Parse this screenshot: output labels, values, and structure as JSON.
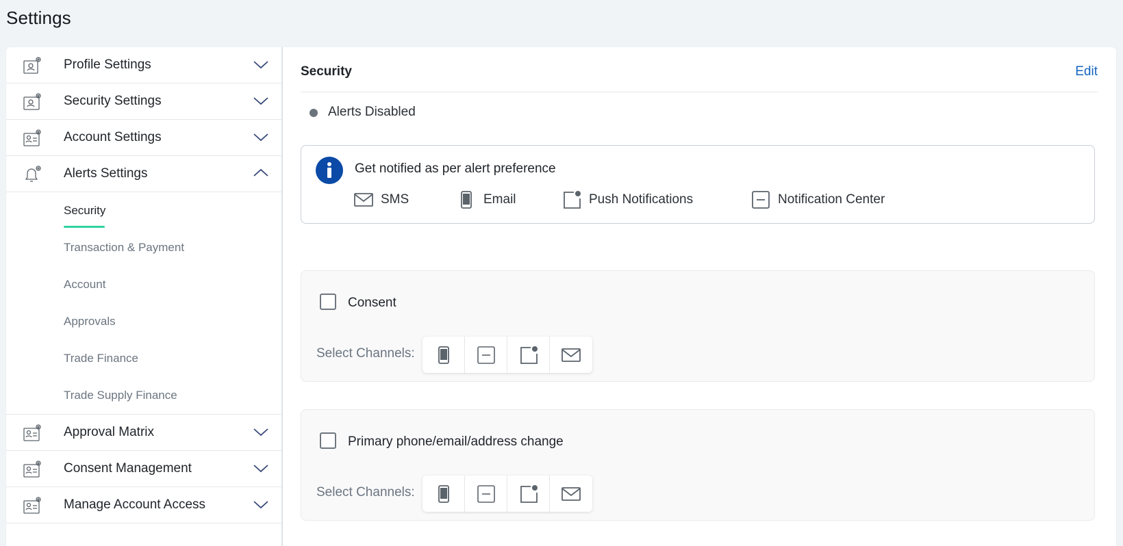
{
  "page": {
    "title": "Settings"
  },
  "sidebar": {
    "items": [
      {
        "label": "Profile Settings",
        "icon": "profile-settings-icon",
        "expanded": false
      },
      {
        "label": "Security Settings",
        "icon": "security-settings-icon",
        "expanded": false
      },
      {
        "label": "Account Settings",
        "icon": "account-settings-icon",
        "expanded": false
      },
      {
        "label": "Alerts Settings",
        "icon": "bell-settings-icon",
        "expanded": true
      },
      {
        "label": "Approval Matrix",
        "icon": "approval-matrix-icon",
        "expanded": false
      },
      {
        "label": "Consent Management",
        "icon": "consent-management-icon",
        "expanded": false
      },
      {
        "label": "Manage Account Access",
        "icon": "account-access-icon",
        "expanded": false
      }
    ],
    "alerts_subitems": [
      {
        "label": "Security",
        "active": true
      },
      {
        "label": "Transaction & Payment",
        "active": false
      },
      {
        "label": "Account",
        "active": false
      },
      {
        "label": "Approvals",
        "active": false
      },
      {
        "label": "Trade Finance",
        "active": false
      },
      {
        "label": "Trade Supply Finance",
        "active": false
      }
    ]
  },
  "main": {
    "title": "Security",
    "edit_label": "Edit",
    "status": {
      "text": "Alerts Disabled",
      "color": "#6b747c"
    },
    "info": {
      "text": "Get notified as per alert preference",
      "channels": [
        {
          "label": "SMS",
          "icon": "mail-icon"
        },
        {
          "label": "Email",
          "icon": "phone-icon"
        },
        {
          "label": "Push Notifications",
          "icon": "push-notification-icon"
        },
        {
          "label": "Notification Center",
          "icon": "notification-center-icon"
        }
      ]
    },
    "alerts": [
      {
        "label": "Consent",
        "checked": false,
        "select_label": "Select Channels:",
        "channels": [
          "phone-icon",
          "notification-center-icon",
          "push-notification-icon",
          "mail-icon"
        ]
      },
      {
        "label": "Primary phone/email/address change",
        "checked": false,
        "select_label": "Select Channels:",
        "channels": [
          "phone-icon",
          "notification-center-icon",
          "push-notification-icon",
          "mail-icon"
        ]
      }
    ]
  },
  "colors": {
    "accent": "#1565c0",
    "active_underline": "#2ed3a0",
    "info_icon": "#0b4aa6"
  }
}
